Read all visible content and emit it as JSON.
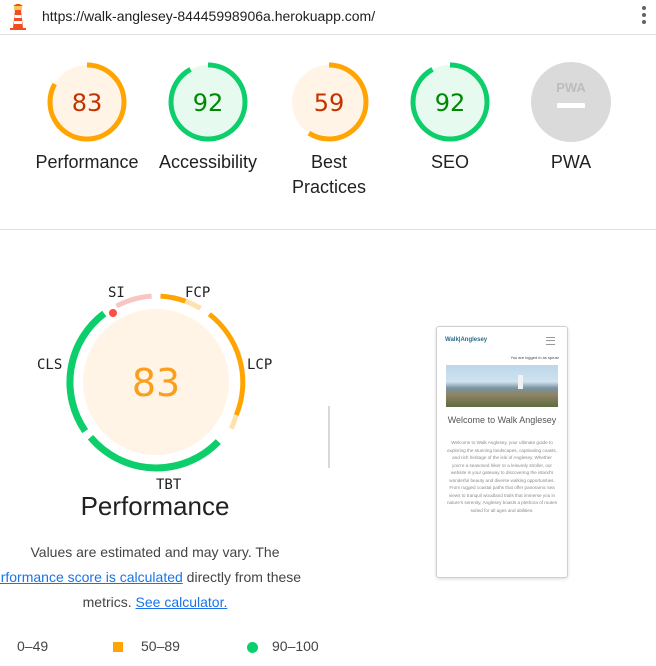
{
  "browser": {
    "url": "https://walk-anglesey-84445998906a.herokuapp.com/"
  },
  "icons": {
    "app_logo": "lighthouse-icon",
    "menu": "kebab-menu-icon"
  },
  "colors": {
    "pass": "#0cce6b",
    "average": "#ffa400",
    "fail": "#ff4e42",
    "pwa": "#cccccc"
  },
  "scores": [
    {
      "key": "performance",
      "value": 83,
      "label": "Performance",
      "status": "average"
    },
    {
      "key": "accessibility",
      "value": 92,
      "label": "Accessibility",
      "status": "pass"
    },
    {
      "key": "best_practices",
      "value": 59,
      "label": "Best\nPractices",
      "status": "average"
    },
    {
      "key": "seo",
      "value": 92,
      "label": "SEO",
      "status": "pass"
    },
    {
      "key": "pwa",
      "value": "PWA",
      "label": "PWA",
      "status": "na"
    }
  ],
  "performance_detail": {
    "score": 83,
    "title": "Performance",
    "metrics": {
      "si": "SI",
      "fcp": "FCP",
      "lcp": "LCP",
      "tbt": "TBT",
      "cls": "CLS"
    }
  },
  "explanation": {
    "line1": "Values are estimated and may vary. The",
    "link1": "erformance score is calculated",
    "line2_rest": " directly from these",
    "line3_pre": "metrics. ",
    "link2": "See calculator."
  },
  "legend": {
    "fail": "0–49",
    "average": "50–89",
    "pass": "90–100"
  },
  "screenshot_preview": {
    "brand": "Walk|Anglesey",
    "login_text": "You are logged in as sprusr",
    "heading": "Welcome to Walk Anglesey",
    "body": "Welcome to Walk Anglesey, your ultimate guide to exploring the stunning landscapes, captivating coasts, and rich heritage of the isle of Anglesey. Whether you're a seasoned hiker or a leisurely stroller, our website is your gateway to discovering the island's wonderful beauty and diverse walking opportunities. From rugged coastal paths that offer panoramic sea views to tranquil woodland trails that immerse you in nature's serenity, Anglesey boasts a plethora of routes suited for all ages and abilities."
  }
}
